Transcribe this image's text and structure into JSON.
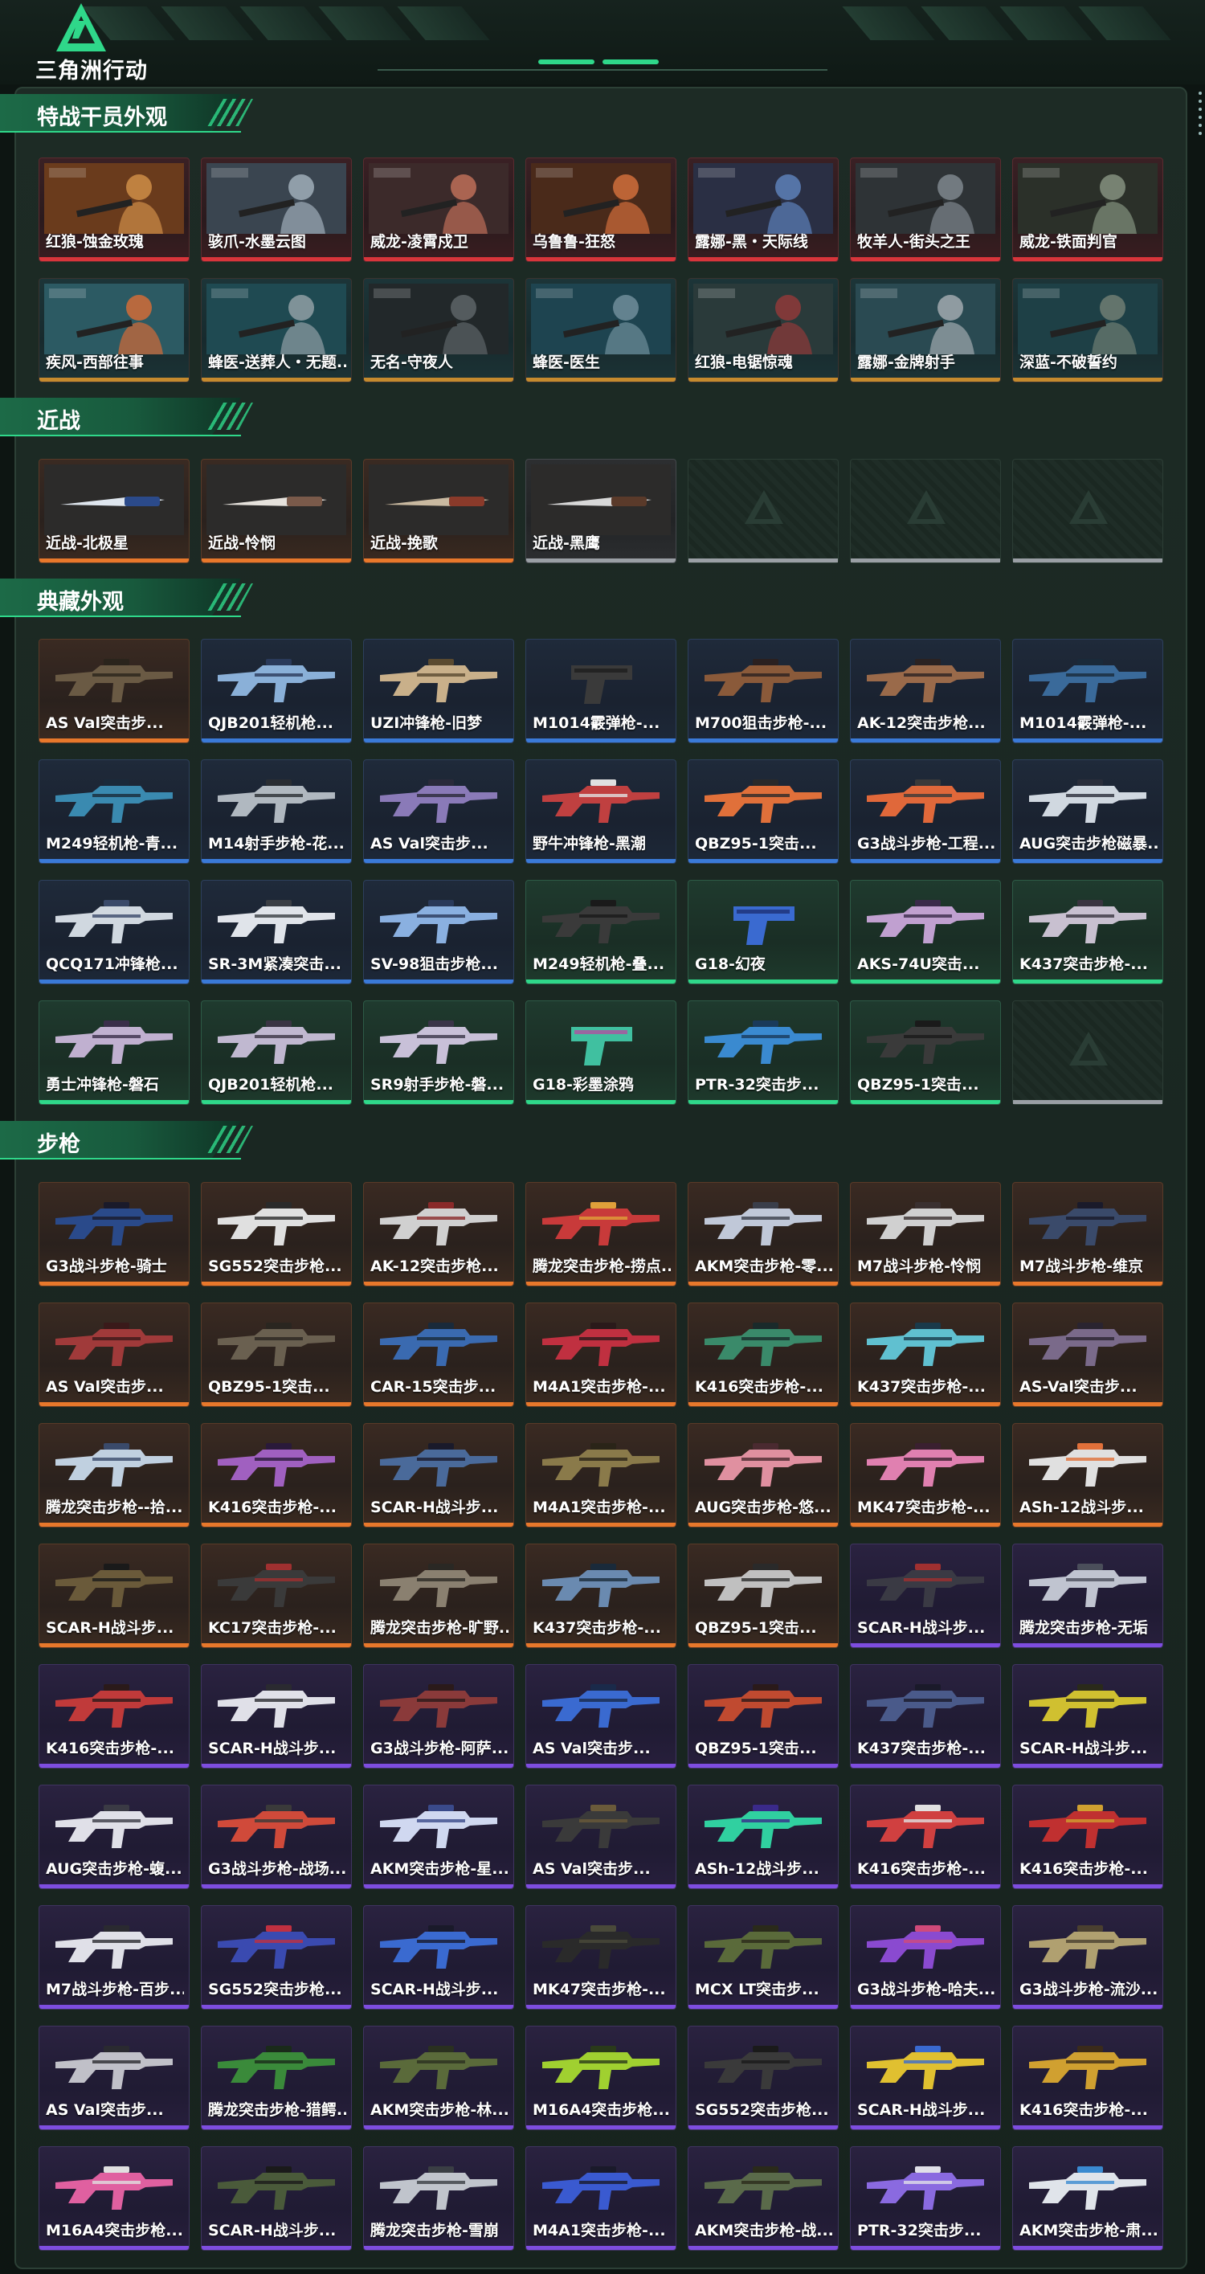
{
  "header": {
    "logo_text": "三角洲行动",
    "accent_color": "#2fd88a"
  },
  "sections": [
    {
      "title": "特战干员外观",
      "items": [
        {
          "label": "红狼-蚀金玫瑰",
          "rarity": "red",
          "art": "operator",
          "c1": "#c98a45",
          "c2": "#6a3b1c"
        },
        {
          "label": "骇爪-水墨云图",
          "rarity": "red",
          "art": "operator",
          "c1": "#9aa7b3",
          "c2": "#3a4550"
        },
        {
          "label": "威龙-凌霄戍卫",
          "rarity": "red",
          "art": "operator",
          "c1": "#b66a55",
          "c2": "#3c2a2a"
        },
        {
          "label": "乌鲁鲁-狂怒",
          "rarity": "red",
          "art": "operator",
          "c1": "#c96a3a",
          "c2": "#4a2a1a"
        },
        {
          "label": "露娜-黑・天际线",
          "rarity": "red",
          "art": "operator",
          "c1": "#5a7cb3",
          "c2": "#2a2f44"
        },
        {
          "label": "牧羊人-街头之王",
          "rarity": "red",
          "art": "operator",
          "c1": "#7a8288",
          "c2": "#2e3336"
        },
        {
          "label": "威龙-铁面判官",
          "rarity": "red",
          "art": "operator",
          "c1": "#7f8c7a",
          "c2": "#2b3029"
        },
        {
          "label": "疾风-西部往事",
          "rarity": "teal",
          "art": "operator",
          "c1": "#c86a3a",
          "c2": "#2c5a63"
        },
        {
          "label": "蜂医-送葬人・无题...",
          "rarity": "teal",
          "art": "operator",
          "c1": "#8a9aa0",
          "c2": "#1f4a52"
        },
        {
          "label": "无名-守夜人",
          "rarity": "teal",
          "art": "operator",
          "c1": "#5a6064",
          "c2": "#22282a"
        },
        {
          "label": "蜂医-医生",
          "rarity": "teal",
          "art": "operator",
          "c1": "#6a8a96",
          "c2": "#1e4450"
        },
        {
          "label": "红狼-电锯惊魂",
          "rarity": "teal",
          "art": "operator",
          "c1": "#8a3a3a",
          "c2": "#2a3a3a"
        },
        {
          "label": "露娜-金牌射手",
          "rarity": "teal",
          "art": "operator",
          "c1": "#9aa4aa",
          "c2": "#2a4a52"
        },
        {
          "label": "深蓝-不破誓约",
          "rarity": "teal",
          "art": "operator",
          "c1": "#6a7a70",
          "c2": "#1e4046"
        }
      ]
    },
    {
      "title": "近战",
      "items": [
        {
          "label": "近战-北极星",
          "rarity": "orange",
          "art": "knife",
          "c1": "#dfe6ee",
          "c2": "#2b4a8a"
        },
        {
          "label": "近战-怜悯",
          "rarity": "orange",
          "art": "knife",
          "c1": "#e6e2dc",
          "c2": "#7a5a4a"
        },
        {
          "label": "近战-挽歌",
          "rarity": "orange",
          "art": "knife",
          "c1": "#c9b9a0",
          "c2": "#8a3a2a"
        },
        {
          "label": "近战-黑鹰",
          "rarity": "grey",
          "art": "knife",
          "c1": "#d8d8d8",
          "c2": "#5a3a2a"
        }
      ],
      "empty_slots": 3
    },
    {
      "title": "典藏外观",
      "items": [
        {
          "label": "AS Val突击步...",
          "rarity": "orange",
          "art": "gun",
          "c1": "#6a5a44",
          "c2": "#2a241c"
        },
        {
          "label": "QJB201轻机枪...",
          "rarity": "blue",
          "art": "gun",
          "c1": "#8ab0d8",
          "c2": "#2a3a5a"
        },
        {
          "label": "UZI冲锋枪-旧梦",
          "rarity": "blue",
          "art": "gun",
          "c1": "#c9b08a",
          "c2": "#5a4a30"
        },
        {
          "label": "M1014霰弹枪-...",
          "rarity": "blue",
          "art": "pistol",
          "c1": "#3a3a3a",
          "c2": "#1a1a1a"
        },
        {
          "label": "M700狙击步枪-...",
          "rarity": "blue",
          "art": "gun",
          "c1": "#8a5a3a",
          "c2": "#2a2020"
        },
        {
          "label": "AK-12突击步枪...",
          "rarity": "blue",
          "art": "gun",
          "c1": "#9a6a4a",
          "c2": "#2a2222"
        },
        {
          "label": "M1014霰弹枪-...",
          "rarity": "blue",
          "art": "gun",
          "c1": "#3a6a9a",
          "c2": "#1a2a3a"
        },
        {
          "label": "M249轻机枪-青...",
          "rarity": "blue",
          "art": "gun",
          "c1": "#3a8ab0",
          "c2": "#1a2a3a"
        },
        {
          "label": "M14射手步枪-花...",
          "rarity": "blue",
          "art": "gun",
          "c1": "#b0b8c0",
          "c2": "#2a2e33"
        },
        {
          "label": "AS Val突击步...",
          "rarity": "blue",
          "art": "gun",
          "c1": "#8a7ab8",
          "c2": "#2a2a3a"
        },
        {
          "label": "野牛冲锋枪-黑潮",
          "rarity": "blue",
          "art": "gun",
          "c1": "#c04040",
          "c2": "#e0e0e0"
        },
        {
          "label": "QBZ95-1突击...",
          "rarity": "blue",
          "art": "gun",
          "c1": "#e0703a",
          "c2": "#2a2a2a"
        },
        {
          "label": "G3战斗步枪-工程...",
          "rarity": "blue",
          "art": "gun",
          "c1": "#e0683a",
          "c2": "#3a3a3a"
        },
        {
          "label": "AUG突击步枪磁暴...",
          "rarity": "blue",
          "art": "gun",
          "c1": "#d0d8e0",
          "c2": "#2a2e3a"
        },
        {
          "label": "QCQ171冲锋枪...",
          "rarity": "blue",
          "art": "gun",
          "c1": "#d0d8e0",
          "c2": "#3a4a6a"
        },
        {
          "label": "SR-3M紧凑突击...",
          "rarity": "blue",
          "art": "gun",
          "c1": "#e0e4ea",
          "c2": "#3a3e44"
        },
        {
          "label": "SV-98狙击步枪...",
          "rarity": "blue",
          "art": "gun",
          "c1": "#8ab0e0",
          "c2": "#2a3a5a"
        },
        {
          "label": "M249轻机枪-叠...",
          "rarity": "green",
          "art": "gun",
          "c1": "#3a3a3a",
          "c2": "#1a1a1a"
        },
        {
          "label": "G18-幻夜",
          "rarity": "green",
          "art": "pistol",
          "c1": "#3a6ad0",
          "c2": "#1a2a6a"
        },
        {
          "label": "AKS-74U突击...",
          "rarity": "green",
          "art": "gun",
          "c1": "#c0a0d0",
          "c2": "#3a2a4a"
        },
        {
          "label": "K437突击步枪-...",
          "rarity": "green",
          "art": "gun",
          "c1": "#c8c0d0",
          "c2": "#3a3440"
        },
        {
          "label": "勇士冲锋枪-磐石",
          "rarity": "green",
          "art": "gun",
          "c1": "#c0b0d0",
          "c2": "#3a2e4a"
        },
        {
          "label": "QJB201轻机枪...",
          "rarity": "green",
          "art": "gun",
          "c1": "#c0b8d0",
          "c2": "#3a3444"
        },
        {
          "label": "SR9射手步枪-磐...",
          "rarity": "green",
          "art": "gun",
          "c1": "#c8c0d8",
          "c2": "#3a3448"
        },
        {
          "label": "G18-彩墨涂鸦",
          "rarity": "green",
          "art": "pistol",
          "c1": "#40c0a0",
          "c2": "#c040a0"
        },
        {
          "label": "PTR-32突击步...",
          "rarity": "green",
          "art": "gun",
          "c1": "#3a8ad0",
          "c2": "#1a3a5a"
        },
        {
          "label": "QBZ95-1突击...",
          "rarity": "green",
          "art": "gun",
          "c1": "#3a3a3a",
          "c2": "#1a1a1a"
        }
      ],
      "empty_slots": 1
    },
    {
      "title": "步枪",
      "items": [
        {
          "label": "G3战斗步枪-骑士",
          "rarity": "orange",
          "art": "gun",
          "c1": "#2a4a8a",
          "c2": "#1a1a2a"
        },
        {
          "label": "SG552突击步枪...",
          "rarity": "orange",
          "art": "gun",
          "c1": "#e0e0e0",
          "c2": "#2a2a2a"
        },
        {
          "label": "AK-12突击步枪...",
          "rarity": "orange",
          "art": "gun",
          "c1": "#d0d0d0",
          "c2": "#8a2a2a"
        },
        {
          "label": "腾龙突击步枪-捞点...",
          "rarity": "orange",
          "art": "gun",
          "c1": "#c83a3a",
          "c2": "#e0a03a"
        },
        {
          "label": "AKM突击步枪-零...",
          "rarity": "orange",
          "art": "gun",
          "c1": "#c0c8d8",
          "c2": "#3a3e4a"
        },
        {
          "label": "M7战斗步枪-怜悯",
          "rarity": "orange",
          "art": "gun",
          "c1": "#d0d0d0",
          "c2": "#3a3030"
        },
        {
          "label": "M7战斗步枪-维京",
          "rarity": "orange",
          "art": "gun",
          "c1": "#3a4a6a",
          "c2": "#1a1a2a"
        },
        {
          "label": "AS Val突击步...",
          "rarity": "orange",
          "art": "gun",
          "c1": "#a03a3a",
          "c2": "#3a1a1a"
        },
        {
          "label": "QBZ95-1突击...",
          "rarity": "orange",
          "art": "gun",
          "c1": "#6a6050",
          "c2": "#2a2620"
        },
        {
          "label": "CAR-15突击步...",
          "rarity": "orange",
          "art": "gun",
          "c1": "#3a6ab0",
          "c2": "#1a2a3a"
        },
        {
          "label": "M4A1突击步枪-...",
          "rarity": "orange",
          "art": "gun",
          "c1": "#c03040",
          "c2": "#2a1a1a"
        },
        {
          "label": "K416突击步枪-...",
          "rarity": "orange",
          "art": "gun",
          "c1": "#3a8a6a",
          "c2": "#1a2a2a"
        },
        {
          "label": "K437突击步枪-...",
          "rarity": "orange",
          "art": "gun",
          "c1": "#60c0d0",
          "c2": "#1a3a4a"
        },
        {
          "label": "AS-Val突击步...",
          "rarity": "orange",
          "art": "gun",
          "c1": "#7a6a8a",
          "c2": "#2a2430"
        },
        {
          "label": "腾龙突击步枪--拾...",
          "rarity": "orange",
          "art": "gun",
          "c1": "#c0d0e0",
          "c2": "#3a4a6a"
        },
        {
          "label": "K416突击步枪-...",
          "rarity": "orange",
          "art": "gun",
          "c1": "#a060c0",
          "c2": "#2a1a3a"
        },
        {
          "label": "SCAR-H战斗步...",
          "rarity": "orange",
          "art": "gun",
          "c1": "#4a6a9a",
          "c2": "#1a1a2a"
        },
        {
          "label": "M4A1突击步枪-...",
          "rarity": "orange",
          "art": "gun",
          "c1": "#8a7a4a",
          "c2": "#2a2418"
        },
        {
          "label": "AUG突击步枪-悠...",
          "rarity": "orange",
          "art": "gun",
          "c1": "#e090a0",
          "c2": "#4a2a30"
        },
        {
          "label": "MK47突击步枪-...",
          "rarity": "orange",
          "art": "gun",
          "c1": "#e080b0",
          "c2": "#3a2030"
        },
        {
          "label": "ASh-12战斗步...",
          "rarity": "orange",
          "art": "gun",
          "c1": "#e0e0e0",
          "c2": "#e0703a"
        },
        {
          "label": "SCAR-H战斗步...",
          "rarity": "orange",
          "art": "gun",
          "c1": "#6a5a3a",
          "c2": "#1a1a1a"
        },
        {
          "label": "KC17突击步枪-...",
          "rarity": "orange",
          "art": "gun",
          "c1": "#3a3a3a",
          "c2": "#a03030"
        },
        {
          "label": "腾龙突击步枪-旷野...",
          "rarity": "orange",
          "art": "gun",
          "c1": "#8a8070",
          "c2": "#2a2824"
        },
        {
          "label": "K437突击步枪-...",
          "rarity": "orange",
          "art": "gun",
          "c1": "#6a8ab0",
          "c2": "#1a2a3a"
        },
        {
          "label": "QBZ95-1突击...",
          "rarity": "orange",
          "art": "gun",
          "c1": "#c0c0c0",
          "c2": "#2a2a2a"
        },
        {
          "label": "SCAR-H战斗步...",
          "rarity": "purple",
          "art": "gun",
          "c1": "#3a3a44",
          "c2": "#a03030"
        },
        {
          "label": "腾龙突击步枪-无垢",
          "rarity": "purple",
          "art": "gun",
          "c1": "#c0c4d0",
          "c2": "#4a4e5a"
        },
        {
          "label": "K416突击步枪-...",
          "rarity": "purple",
          "art": "gun",
          "c1": "#c03a3a",
          "c2": "#2a1a1a"
        },
        {
          "label": "SCAR-H战斗步...",
          "rarity": "purple",
          "art": "gun",
          "c1": "#e0e0e8",
          "c2": "#2a2a30"
        },
        {
          "label": "G3战斗步枪-阿萨...",
          "rarity": "purple",
          "art": "gun",
          "c1": "#8a3a3a",
          "c2": "#2a1a1a"
        },
        {
          "label": "AS Val突击步...",
          "rarity": "purple",
          "art": "gun",
          "c1": "#3a6ad0",
          "c2": "#1a2a4a"
        },
        {
          "label": "QBZ95-1突击...",
          "rarity": "purple",
          "art": "gun",
          "c1": "#c04a30",
          "c2": "#2a1a1a"
        },
        {
          "label": "K437突击步枪-...",
          "rarity": "purple",
          "art": "gun",
          "c1": "#4a5a8a",
          "c2": "#1a1a2a"
        },
        {
          "label": "SCAR-H战斗步...",
          "rarity": "purple",
          "art": "gun",
          "c1": "#d0c030",
          "c2": "#2a2a1a"
        },
        {
          "label": "AUG突击步枪-蝮...",
          "rarity": "purple",
          "art": "gun",
          "c1": "#e0e0e8",
          "c2": "#3a3a44"
        },
        {
          "label": "G3战斗步枪-战场...",
          "rarity": "purple",
          "art": "gun",
          "c1": "#d04a3a",
          "c2": "#3a3a3a"
        },
        {
          "label": "AKM突击步枪-星...",
          "rarity": "purple",
          "art": "gun",
          "c1": "#d0d8f0",
          "c2": "#3a4a8a"
        },
        {
          "label": "AS Val突击步...",
          "rarity": "purple",
          "art": "gun",
          "c1": "#3a3a3a",
          "c2": "#6a5a3a"
        },
        {
          "label": "ASh-12战斗步...",
          "rarity": "purple",
          "art": "gun",
          "c1": "#30d0a0",
          "c2": "#3a2a8a"
        },
        {
          "label": "K416突击步枪-...",
          "rarity": "purple",
          "art": "gun",
          "c1": "#d04040",
          "c2": "#e0e0e0"
        },
        {
          "label": "K416突击步枪-...",
          "rarity": "purple",
          "art": "gun",
          "c1": "#c03030",
          "c2": "#d0a030"
        },
        {
          "label": "M7战斗步枪-百步...",
          "rarity": "purple",
          "art": "gun",
          "c1": "#e0e0e8",
          "c2": "#2a2a30"
        },
        {
          "label": "SG552突击步枪...",
          "rarity": "purple",
          "art": "gun",
          "c1": "#3a4ab0",
          "c2": "#c03040"
        },
        {
          "label": "SCAR-H战斗步...",
          "rarity": "purple",
          "art": "gun",
          "c1": "#3a6ad0",
          "c2": "#1a1a2a"
        },
        {
          "label": "MK47突击步枪-...",
          "rarity": "purple",
          "art": "gun",
          "c1": "#2a2a2a",
          "c2": "#4a4a3a"
        },
        {
          "label": "MCX LT突击步...",
          "rarity": "purple",
          "art": "gun",
          "c1": "#5a6a3a",
          "c2": "#2a2a1a"
        },
        {
          "label": "G3战斗步枪-哈夫...",
          "rarity": "purple",
          "art": "gun",
          "c1": "#8a4ad0",
          "c2": "#d04a7a"
        },
        {
          "label": "G3战斗步枪-流沙...",
          "rarity": "purple",
          "art": "gun",
          "c1": "#b0a070",
          "c2": "#4a4030"
        },
        {
          "label": "AS Val突击步...",
          "rarity": "purple",
          "art": "gun",
          "c1": "#c0c0c8",
          "c2": "#2a2a30"
        },
        {
          "label": "腾龙突击步枪-猎鳄...",
          "rarity": "purple",
          "art": "gun",
          "c1": "#3a8a3a",
          "c2": "#1a2a1a"
        },
        {
          "label": "AKM突击步枪-林...",
          "rarity": "purple",
          "art": "gun",
          "c1": "#5a6a3a",
          "c2": "#2a3020"
        },
        {
          "label": "M16A4突击步枪...",
          "rarity": "purple",
          "art": "gun",
          "c1": "#a0d030",
          "c2": "#2a3a1a"
        },
        {
          "label": "SG552突击步枪...",
          "rarity": "purple",
          "art": "gun",
          "c1": "#3a3a3a",
          "c2": "#1a1a1a"
        },
        {
          "label": "SCAR-H战斗步...",
          "rarity": "purple",
          "art": "gun",
          "c1": "#e0c030",
          "c2": "#3a6ad0"
        },
        {
          "label": "K416突击步枪-...",
          "rarity": "purple",
          "art": "gun",
          "c1": "#d0a030",
          "c2": "#3a2a1a"
        },
        {
          "label": "M16A4突击步枪...",
          "rarity": "purple",
          "art": "gun",
          "c1": "#e060a0",
          "c2": "#e0e0e0"
        },
        {
          "label": "SCAR-H战斗步...",
          "rarity": "purple",
          "art": "gun",
          "c1": "#4a5a3a",
          "c2": "#1a1a1a"
        },
        {
          "label": "腾龙突击步枪-雪崩",
          "rarity": "purple",
          "art": "gun",
          "c1": "#c0c4cc",
          "c2": "#3a3e44"
        },
        {
          "label": "M4A1突击步枪-...",
          "rarity": "purple",
          "art": "gun",
          "c1": "#3a5ad0",
          "c2": "#1a1a2a"
        },
        {
          "label": "AKM突击步枪-战...",
          "rarity": "purple",
          "art": "gun",
          "c1": "#5a6a4a",
          "c2": "#2a2a1a"
        },
        {
          "label": "PTR-32突击步...",
          "rarity": "purple",
          "art": "gun",
          "c1": "#8a6ae0",
          "c2": "#e0e0e8"
        },
        {
          "label": "AKM突击步枪-肃...",
          "rarity": "purple",
          "art": "gun",
          "c1": "#e0e4ea",
          "c2": "#3a8ad0"
        }
      ]
    }
  ]
}
